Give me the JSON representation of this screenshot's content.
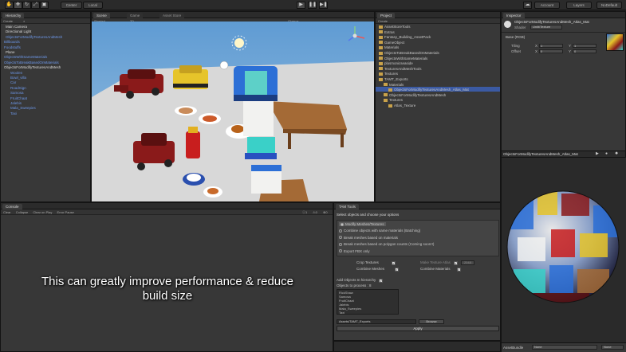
{
  "toolbar": {
    "center_label": "Center",
    "local_label": "Local",
    "account_label": "Account",
    "layers_label": "Layers",
    "layout_label": "NoDefault"
  },
  "hierarchy": {
    "tab": "Hierarchy",
    "create": "Create",
    "items": [
      {
        "label": "Main Camera",
        "style": "white"
      },
      {
        "label": "Directional Light",
        "style": "white"
      },
      {
        "label": "ObjectsForModifyTexturesAndMesh",
        "style": "blue"
      },
      {
        "label": "Billboards",
        "style": "blue"
      },
      {
        "label": "Foodstuffs",
        "style": "blue"
      },
      {
        "label": "Plane",
        "style": "white"
      },
      {
        "label": "ObjectsWithSameMaterials",
        "style": "blue"
      },
      {
        "label": "ObjectsToBreakBasedOnMaterials",
        "style": "blue"
      },
      {
        "label": "ObjectsForModifyTexturesAndMesh",
        "style": "white"
      },
      {
        "label": "Woolen",
        "style": "blue"
      },
      {
        "label": "Bowl_villa",
        "style": "blue"
      },
      {
        "label": "Car",
        "style": "blue"
      },
      {
        "label": "RoadSign",
        "style": "blue"
      },
      {
        "label": "Samosa",
        "style": "blue"
      },
      {
        "label": "FruitChaat",
        "style": "blue"
      },
      {
        "label": "Jalebis",
        "style": "blue"
      },
      {
        "label": "Mala_Sweepies",
        "style": "blue"
      },
      {
        "label": "Taxi",
        "style": "blue"
      }
    ]
  },
  "scene": {
    "tabs": [
      "Scene",
      "Game",
      "Asset Store"
    ],
    "shaded": "Shaded",
    "twod": "2D",
    "gizmos": "Gizmos"
  },
  "project": {
    "tab": "Project",
    "create": "Create",
    "items": [
      {
        "label": "AssetStoreTools",
        "indent": 0
      },
      {
        "label": "Extras",
        "indent": 0
      },
      {
        "label": "Fantasy_Building_AssetPack",
        "indent": 0
      },
      {
        "label": "GameObject",
        "indent": 0
      },
      {
        "label": "Materials",
        "indent": 0
      },
      {
        "label": "ObjectsToBreakBasedOnMaterials",
        "indent": 0
      },
      {
        "label": "ObjectsWithSameMaterials",
        "indent": 0
      },
      {
        "label": "plasmonicseaside",
        "indent": 0
      },
      {
        "label": "TexturesAndMeshTools",
        "indent": 0
      },
      {
        "label": "Textures",
        "indent": 0
      },
      {
        "label": "TAMT_Exports",
        "indent": 0
      },
      {
        "label": "Materials",
        "indent": 1
      },
      {
        "label": "ObjectsForModifyTexturesAndMesh_Atlas_Mat",
        "indent": 2
      },
      {
        "label": "ObjectsForModifyTexturesAndMesh",
        "indent": 1
      },
      {
        "label": "Textures",
        "indent": 1
      },
      {
        "label": "Atlas_Texture",
        "indent": 2
      }
    ]
  },
  "inspector": {
    "tab": "Inspector",
    "object_name": "ObjectsForModifyTexturesAndMesh_Atlas_Mat",
    "shader_label": "Shader",
    "shader_value": "Unlit/Texture",
    "base_label": "Base (RGB)",
    "tiling_label": "Tiling",
    "offset_label": "Offset",
    "x": "X",
    "y": "Y",
    "tiling_x": "1",
    "tiling_y": "1",
    "offset_x": "0",
    "offset_y": "0",
    "preview_title": "ObjectsForModifyTexturesAndMesh_Atlas_Mat",
    "asset_bundle_label": "AssetBundle",
    "asset_bundle_value": "None",
    "asset_bundle_value2": "None"
  },
  "console": {
    "tab": "Console",
    "buttons": [
      "Clear",
      "Collapse",
      "Clear on Play",
      "Error Pause"
    ],
    "counts": [
      "1",
      "0",
      "0"
    ]
  },
  "tam": {
    "tab": "TAM Tools",
    "heading": "Select objects and choose your options",
    "options": [
      {
        "label": "Modify Meshes/Textures",
        "on": true
      },
      {
        "label": "Combine objects with same materials (Batching)",
        "on": false
      },
      {
        "label": "Break meshes based on materials",
        "on": false
      },
      {
        "label": "Break meshes based on polygon counts  (Coming soon!!)",
        "on": false
      },
      {
        "label": "Export FBX only",
        "on": false
      }
    ],
    "crop_textures": "Crop Textures",
    "make_texture_atlas": "Make Texture Atlas",
    "atlas_size": "2048",
    "combine_meshes": "Combine Meshes",
    "combine_materials": "Combine Materials",
    "add_objects": "Add Objects In hierarchy",
    "objects_to_process": "Objects to process : 8",
    "objects_list": [
      "RickShaw",
      "Samosa",
      "FruitChaat",
      "Jalebis",
      "Mala_Sweepies",
      "Taxi"
    ],
    "path_value": "Assets/TAMT_Exports",
    "browse": "Browse",
    "apply": "Apply"
  },
  "caption": {
    "line1": "This can greatly improve performance & reduce",
    "line2": "build size"
  },
  "colors": {
    "accent_blue": "#3b5aa3",
    "hierarchy_blue": "#6d97e8",
    "sky": "#6aa3d6",
    "ground": "#d6d6d6"
  }
}
